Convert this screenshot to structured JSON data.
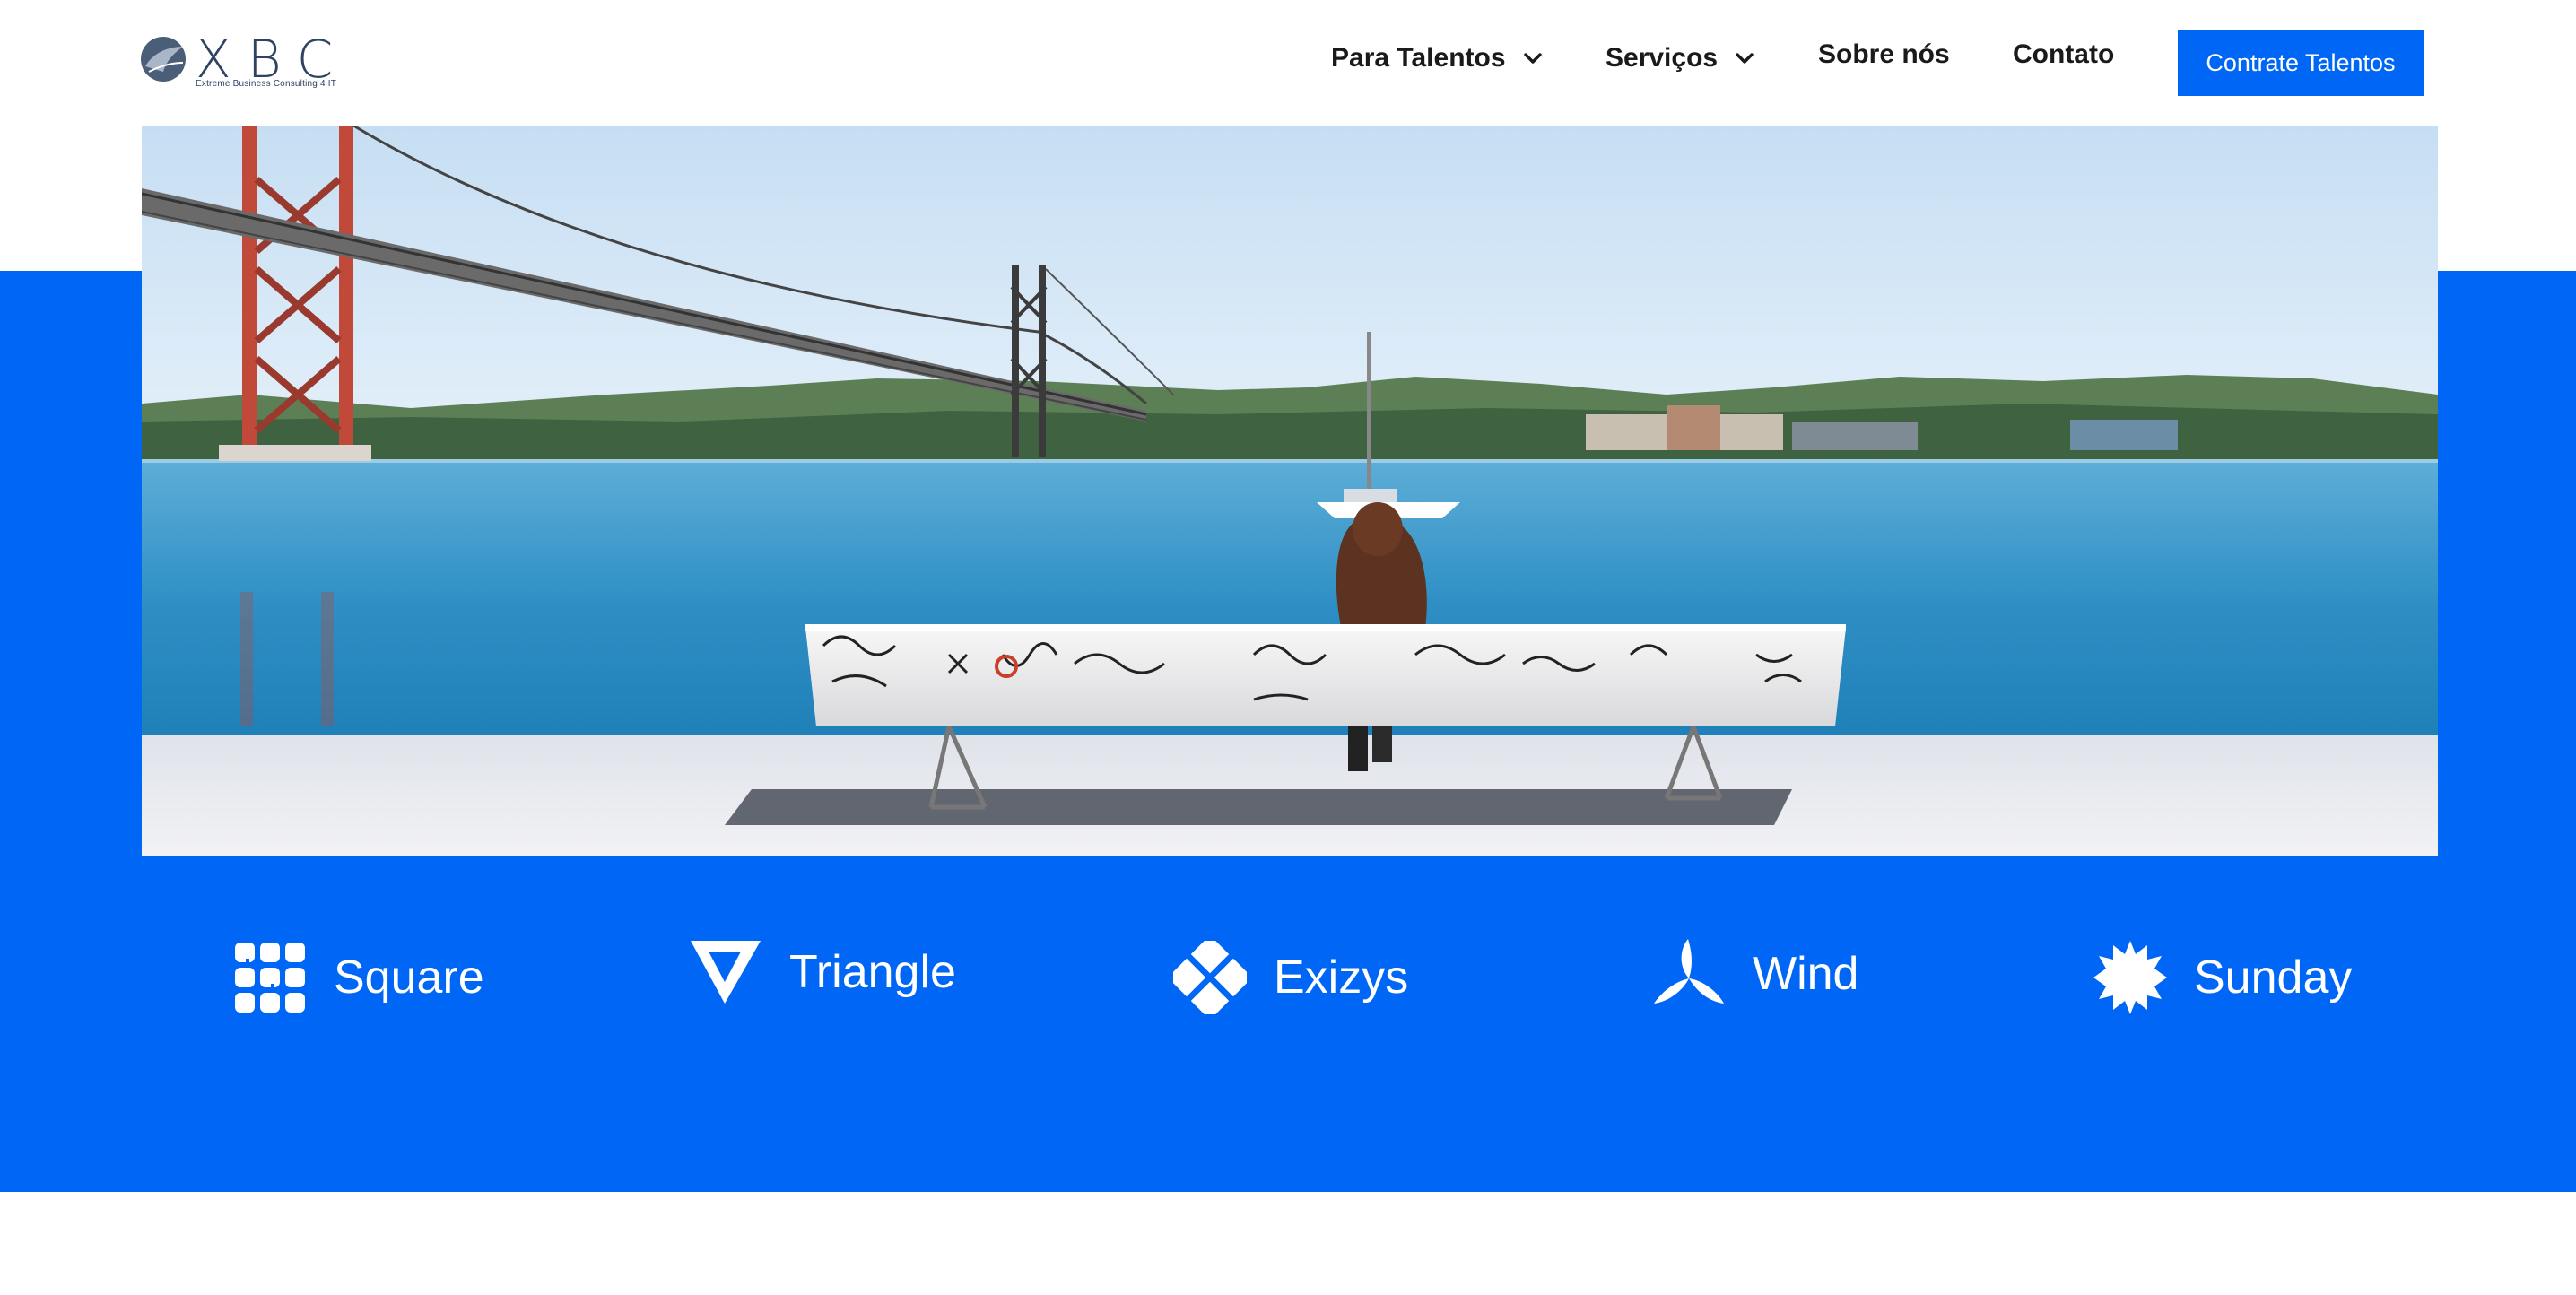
{
  "logo": {
    "name": "XBC",
    "tagline": "Extreme Business Consulting 4 IT"
  },
  "nav": {
    "items": [
      {
        "label": "Para Talentos",
        "has_dropdown": true
      },
      {
        "label": "Serviços",
        "has_dropdown": true
      },
      {
        "label": "Sobre nós",
        "has_dropdown": false
      },
      {
        "label": "Contato",
        "has_dropdown": false
      }
    ],
    "cta_label": "Contrate Talentos"
  },
  "brands": [
    {
      "name": "Square",
      "icon": "grid-square-icon"
    },
    {
      "name": "Triangle",
      "icon": "triangle-check-icon"
    },
    {
      "name": "Exizys",
      "icon": "cross-diamond-icon"
    },
    {
      "name": "Wind",
      "icon": "wind-turbine-icon"
    },
    {
      "name": "Sunday",
      "icon": "starburst-icon"
    }
  ],
  "colors": {
    "accent": "#0066f5",
    "text_dark": "#1a1a1a",
    "logo_navy": "#2e4360",
    "white": "#ffffff"
  }
}
